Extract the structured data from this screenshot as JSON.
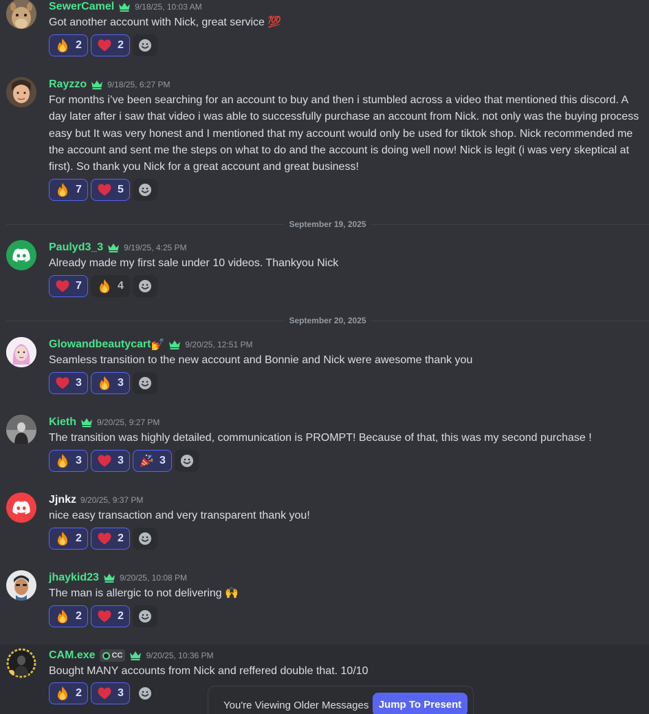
{
  "colors": {
    "background": "#323339",
    "username_green": "#4be38d",
    "reaction_selected_bg": "#2f3360",
    "reaction_selected_border": "#5865f2",
    "jump_button": "#5865f2"
  },
  "messages": [
    {
      "username": "SewerCamel",
      "timestamp": "9/18/25, 10:03 AM",
      "text": "Got another account with Nick, great service 💯",
      "reactions": [
        {
          "emoji": "🔥",
          "count": "2"
        },
        {
          "emoji": "❤️",
          "count": "2"
        }
      ]
    },
    {
      "username": "Rayzzo",
      "timestamp": "9/18/25, 6:27 PM",
      "text": "For months i’ve been searching for an account to buy and then i stumbled across a video that mentioned this discord. A day later after i saw that video i was able to successfully purchase an account from Nick. not only was the buying process easy but It was very honest and I mentioned that my account would only be used for tiktok shop. Nick recommended me the account and sent me the steps on what to do and the account is doing well now! Nick is legit (i was very skeptical at first). So thank you Nick for a great account and great business!",
      "reactions": [
        {
          "emoji": "🔥",
          "count": "7"
        },
        {
          "emoji": "❤️",
          "count": "5"
        }
      ]
    },
    {
      "username": "Paulyd3_3",
      "timestamp": "9/19/25, 4:25 PM",
      "text": "Already made my first sale under 10 videos. Thankyou Nick",
      "reactions": [
        {
          "emoji": "❤️",
          "count": "7"
        },
        {
          "emoji": "🔥",
          "count": "4"
        }
      ]
    },
    {
      "username": "Glowandbeautycart",
      "username_emoji": "💅",
      "timestamp": "9/20/25, 12:51 PM",
      "text": "Seamless transition to the new account and Bonnie and Nick were awesome thank you",
      "reactions": [
        {
          "emoji": "❤️",
          "count": "3"
        },
        {
          "emoji": "🔥",
          "count": "3"
        }
      ]
    },
    {
      "username": "Kieth",
      "timestamp": "9/20/25, 9:27 PM",
      "text": "The transition was highly detailed, communication is PROMPT! Because of that, this was my second purchase !",
      "reactions": [
        {
          "emoji": "🔥",
          "count": "3"
        },
        {
          "emoji": "❤️",
          "count": "3"
        },
        {
          "emoji": "🎉",
          "count": "3"
        }
      ]
    },
    {
      "username": "Jjnkz",
      "timestamp": "9/20/25, 9:37 PM",
      "text": "nice easy transaction and very transparent thank you!",
      "reactions": [
        {
          "emoji": "🔥",
          "count": "2"
        },
        {
          "emoji": "❤️",
          "count": "2"
        }
      ]
    },
    {
      "username": "jhaykid23",
      "timestamp": "9/20/25, 10:08 PM",
      "text": "The man is allergic to not delivering 🙌",
      "reactions": [
        {
          "emoji": "🔥",
          "count": "2"
        },
        {
          "emoji": "❤️",
          "count": "2"
        }
      ]
    },
    {
      "username": "CAM.exe",
      "tag": "CC",
      "timestamp": "9/20/25, 10:36 PM",
      "text": "Bought MANY accounts from Nick and reffered double that. 10/10",
      "reactions": [
        {
          "emoji": "🔥",
          "count": "2"
        },
        {
          "emoji": "❤️",
          "count": "3"
        }
      ]
    }
  ],
  "dividers": [
    "September 19, 2025",
    "September 20, 2025"
  ],
  "older_bar": {
    "text": "You're Viewing Older Messages",
    "button": "Jump To Present"
  }
}
